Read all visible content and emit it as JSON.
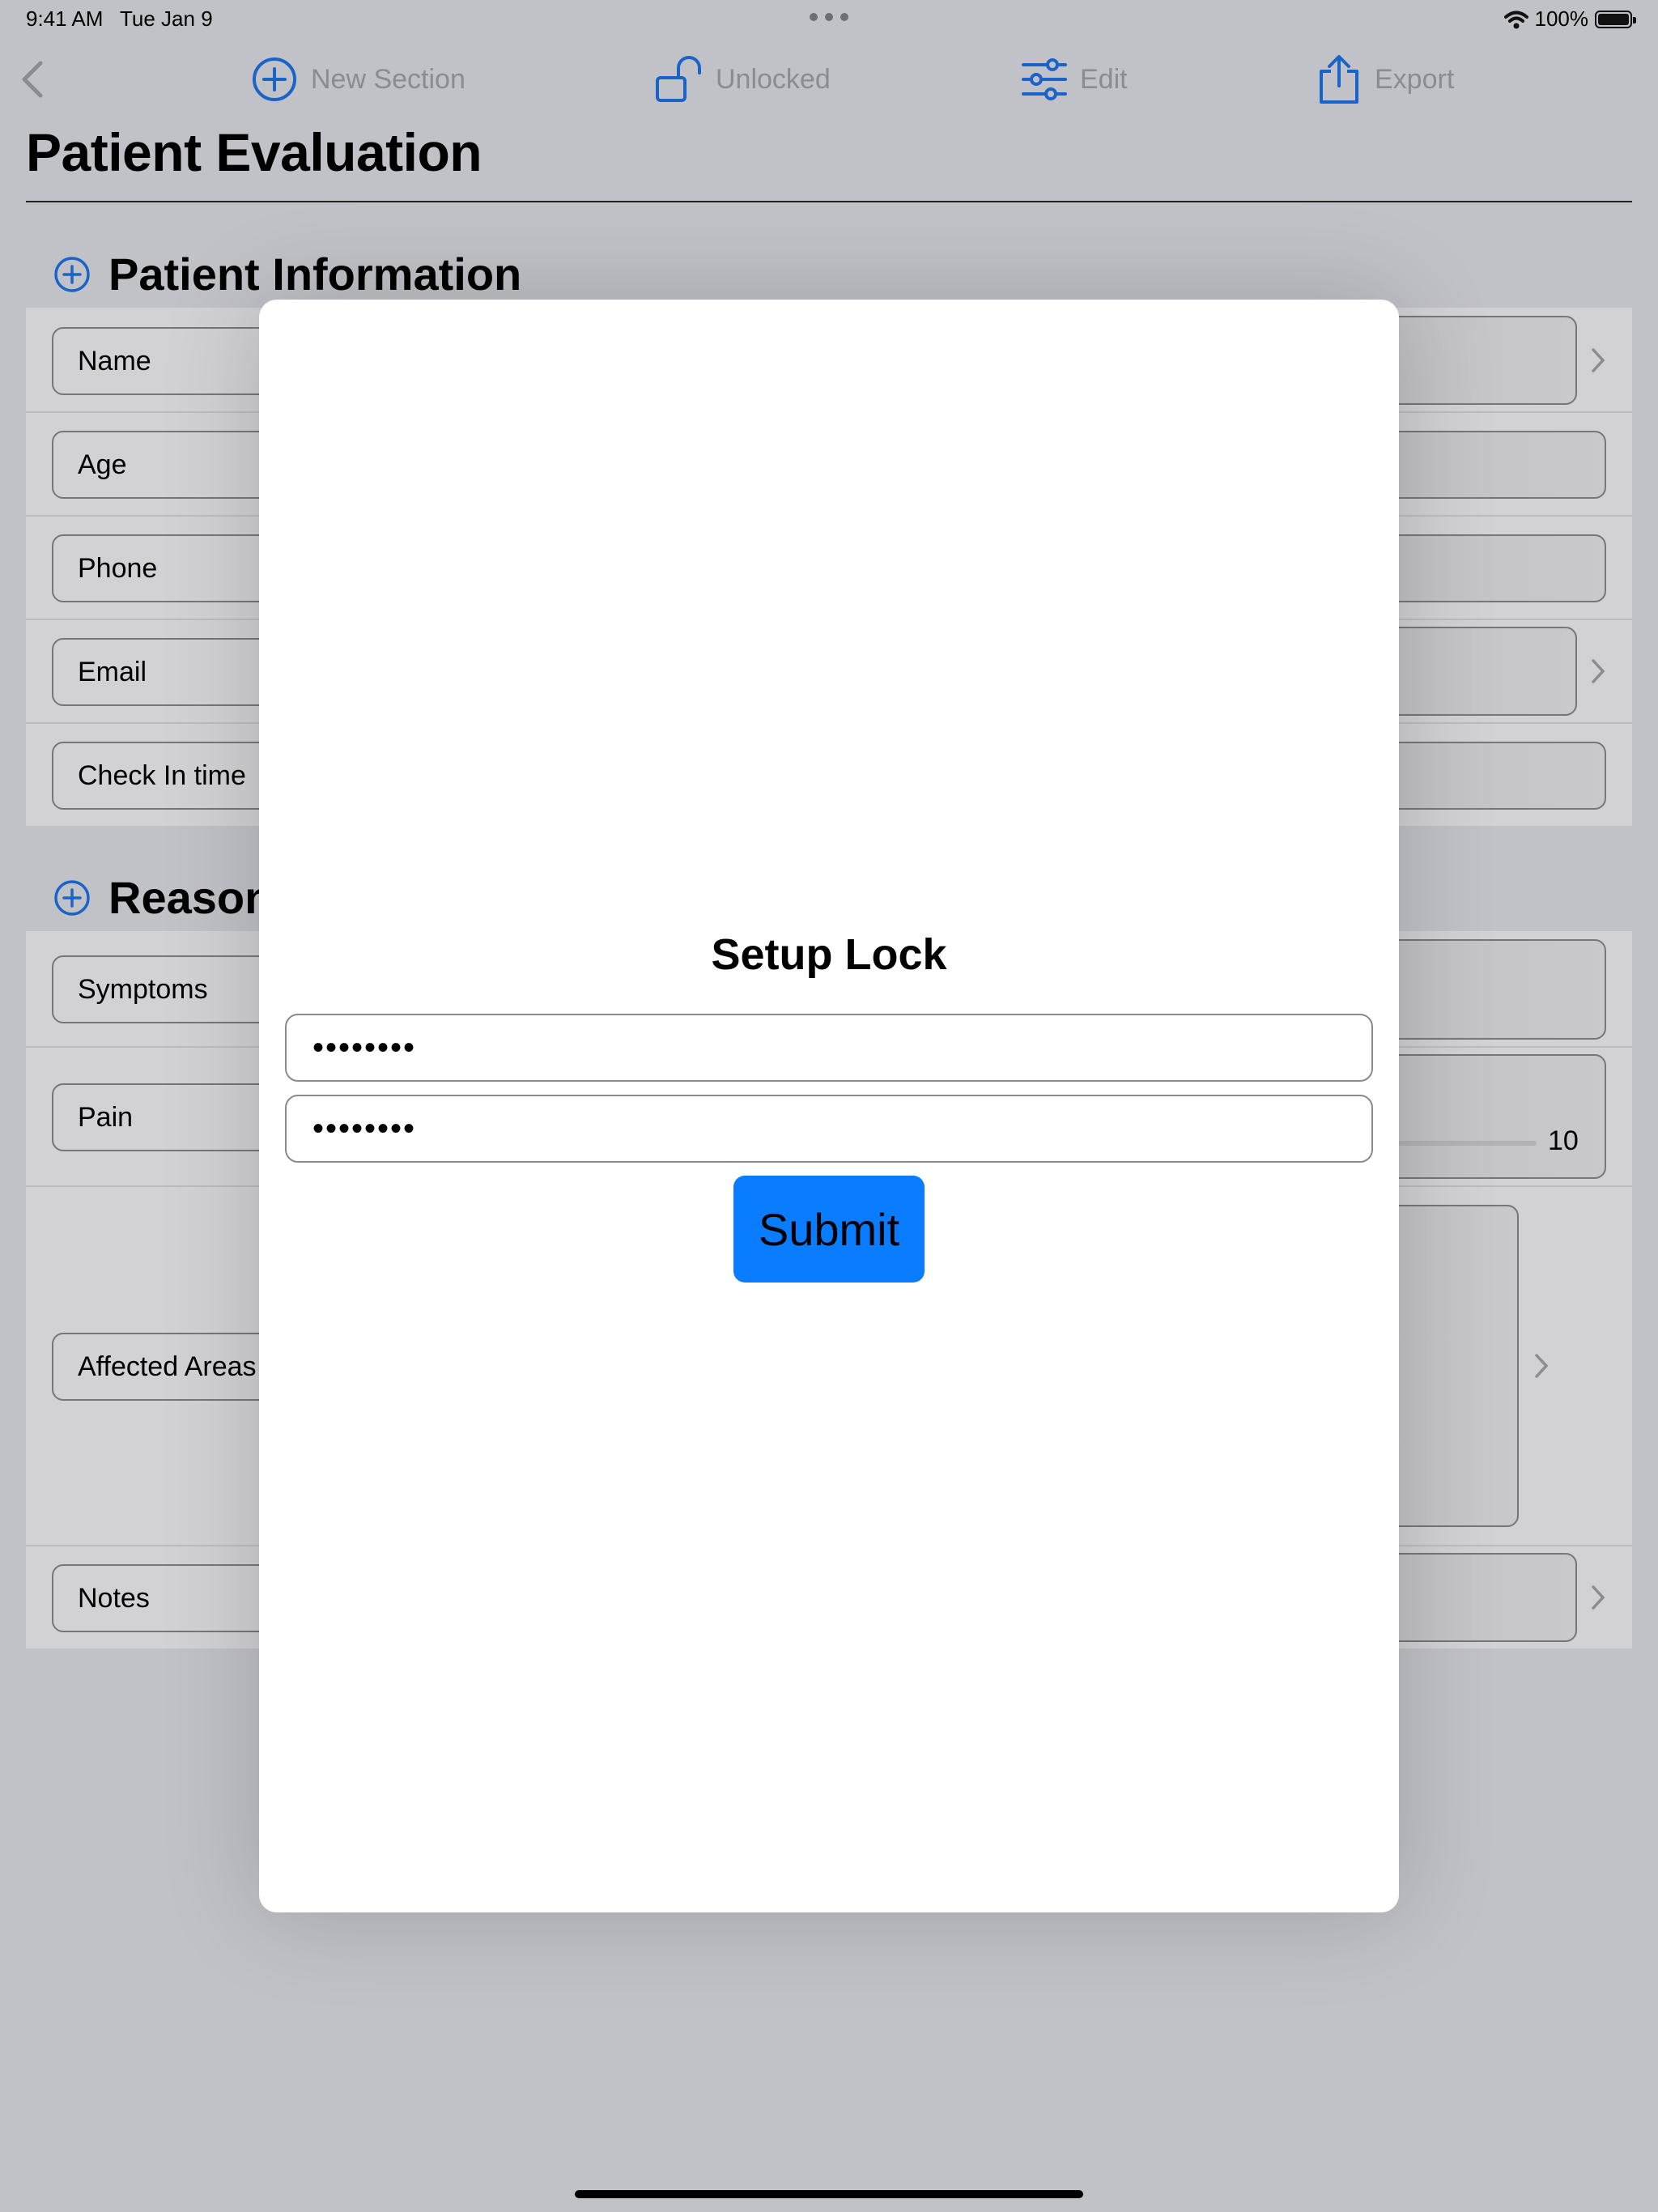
{
  "status_bar": {
    "time": "9:41 AM",
    "date": "Tue Jan 9",
    "battery": "100%"
  },
  "toolbar": {
    "new_section": "New Section",
    "unlocked": "Unlocked",
    "edit": "Edit",
    "export": "Export"
  },
  "page": {
    "title": "Patient Evaluation"
  },
  "sections": [
    {
      "title": "Patient Information",
      "fields": [
        "Name",
        "Age",
        "Phone",
        "Email",
        "Check In time"
      ]
    },
    {
      "title": "Reason",
      "fields": [
        "Symptoms",
        "Pain",
        "Affected Areas",
        "Notes"
      ]
    }
  ],
  "pain_slider": {
    "max_label": "10"
  },
  "modal": {
    "title": "Setup Lock",
    "password_value": "••••••••",
    "confirm_value": "••••••••",
    "submit_label": "Submit"
  },
  "colors": {
    "accent": "#1a64c8",
    "submit": "#0a7cff",
    "dimmed_background": "#c1c2c7",
    "modal": "#ffffff"
  },
  "icons": [
    "chevron-left-icon",
    "plus-circle-icon",
    "unlock-icon",
    "sliders-icon",
    "share-icon",
    "chevron-right-icon",
    "wifi-icon",
    "battery-icon",
    "more-dots-icon"
  ]
}
